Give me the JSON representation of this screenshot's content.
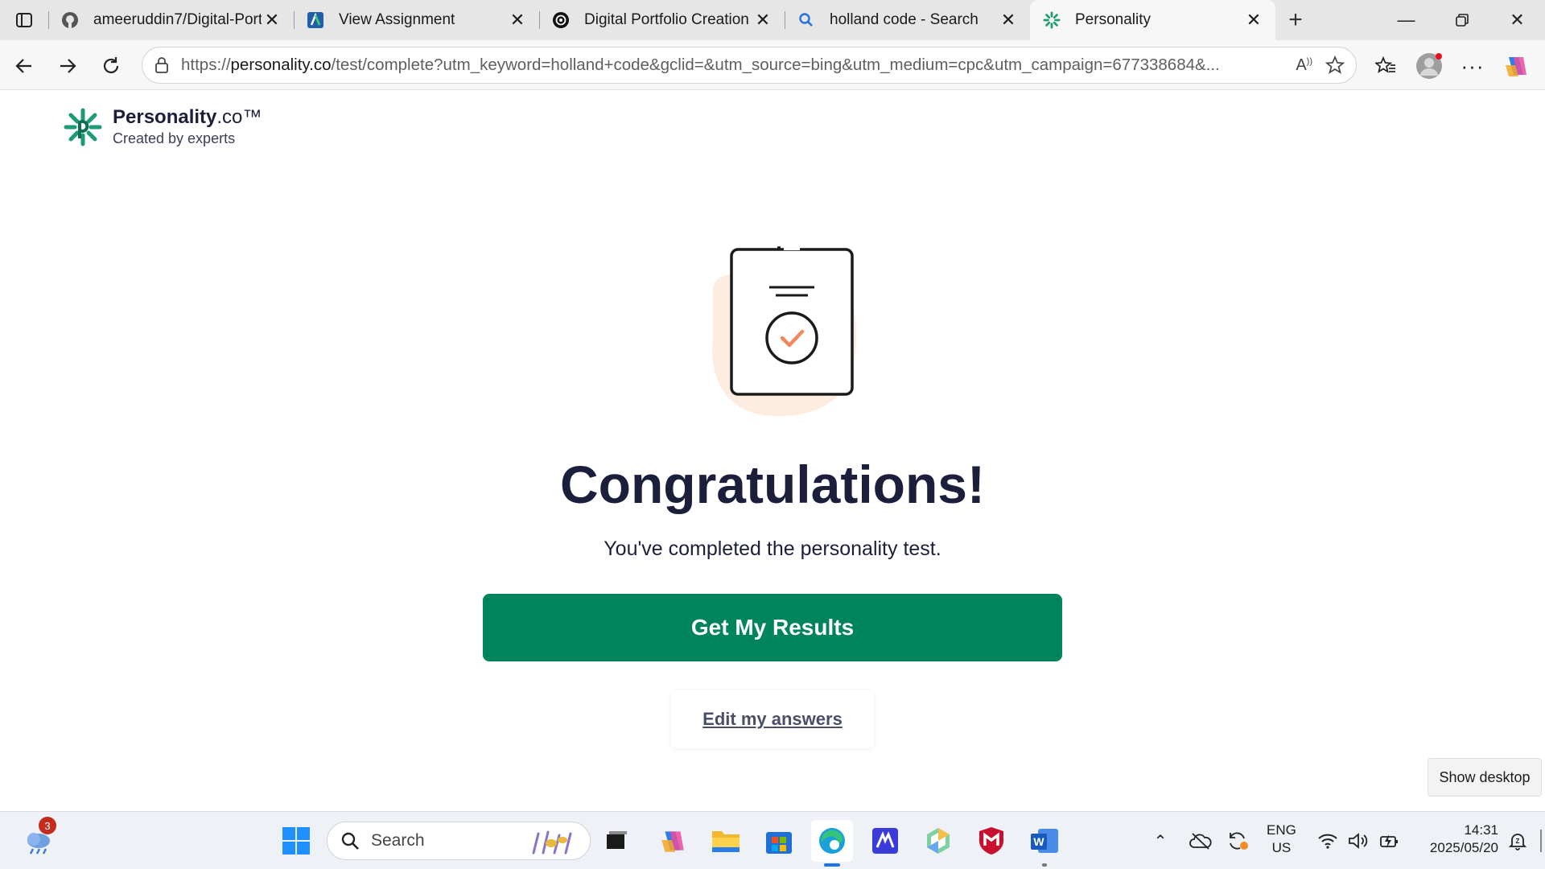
{
  "browser": {
    "tabs": [
      {
        "label": "ameeruddin7/Digital-Portfo",
        "icon": "github-icon"
      },
      {
        "label": "View Assignment",
        "icon": "assignment-icon"
      },
      {
        "label": "Digital Portfolio Creation",
        "icon": "chatgpt-icon"
      },
      {
        "label": "holland code - Search",
        "icon": "search-icon"
      },
      {
        "label": "Personality",
        "icon": "personality-logo-icon",
        "active": true
      }
    ],
    "url_prefix": "https://",
    "url_domain": "personality.co",
    "url_rest": "/test/complete?utm_keyword=holland+code&gclid=&utm_source=bing&utm_medium=cpc&utm_campaign=677338684&..."
  },
  "page": {
    "brand_name": "Personality",
    "brand_suffix": ".co™",
    "brand_tagline": "Created by experts",
    "title": "Congratulations!",
    "subtitle": "You've completed the personality test.",
    "cta_label": "Get My Results",
    "edit_label": "Edit my answers",
    "accent_color": "#00845c",
    "illustration_accent": "#f08a5d"
  },
  "taskbar": {
    "search_placeholder": "Search",
    "weather_badge": "3",
    "lang_top": "ENG",
    "lang_bottom": "US",
    "time": "14:31",
    "date": "2025/05/20",
    "show_desktop": "Show desktop"
  }
}
